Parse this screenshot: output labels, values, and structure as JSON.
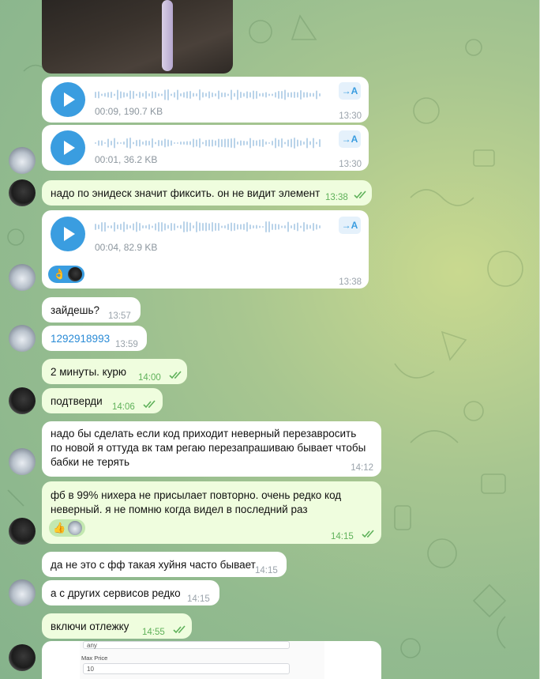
{
  "messages": {
    "voice1": {
      "meta": "00:09, 190.7 KB",
      "time": "13:30",
      "translate": "→A"
    },
    "voice2": {
      "meta": "00:01, 36.2 KB",
      "time": "13:30",
      "translate": "→A"
    },
    "m3": {
      "text": "надо по энидеск значит фиксить. он не видит элемент",
      "time": "13:38"
    },
    "voice3": {
      "meta": "00:04, 82.9 KB",
      "time": "13:38",
      "translate": "→A",
      "reaction": "👌"
    },
    "m5": {
      "text": "зайдешь?",
      "time": "13:57"
    },
    "m6": {
      "text": "1292918993",
      "time": "13:59"
    },
    "m7": {
      "text": "2 минуты. курю",
      "time": "14:00"
    },
    "m8": {
      "text": "подтверди",
      "time": "14:06"
    },
    "m9": {
      "lines": [
        "надо бы сделать если код приходит неверный перезавросить",
        "по новой я оттуда вк там регаю перезапрашиваю бывает чтобы",
        "бабки не терять"
      ],
      "time": "14:12"
    },
    "m10": {
      "lines": [
        "фб в 99% нихера не присылает повторно. очень редко код",
        "неверный. я не помню когда видел в последний раз"
      ],
      "time": "14:15",
      "reaction": "👍"
    },
    "m11": {
      "text": "да не это с фф такая хуйня часто бывает",
      "time": "14:15"
    },
    "m12": {
      "text": "а с других сервисов редко",
      "time": "14:15"
    },
    "m13": {
      "text": "включи отлежку",
      "time": "14:55"
    },
    "screenshot": {
      "select_value": "any",
      "field_label": "Max Price",
      "field_value": "10"
    }
  },
  "colors": {
    "incoming": "#ffffff",
    "outgoing": "#effdde",
    "accent": "#3a9de0",
    "out_time": "#5fb15a"
  }
}
